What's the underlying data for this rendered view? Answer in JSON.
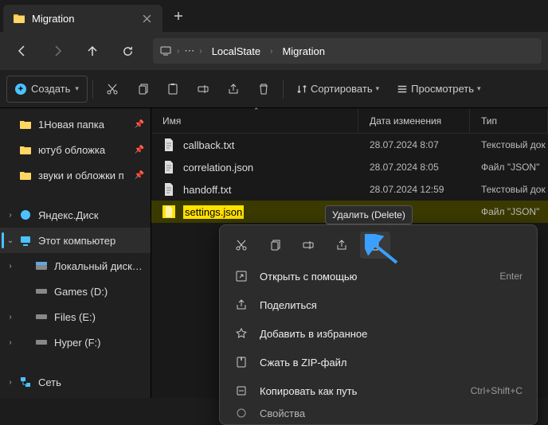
{
  "tab": {
    "title": "Migration"
  },
  "breadcrumb": {
    "items": [
      "LocalState",
      "Migration"
    ]
  },
  "toolbar": {
    "new_label": "Создать",
    "sort_label": "Сортировать",
    "view_label": "Просмотреть"
  },
  "sidebar": {
    "quick": [
      {
        "label": "1Новая папка",
        "pinned": true,
        "icon": "folder"
      },
      {
        "label": "ютуб обложка",
        "pinned": true,
        "icon": "folder"
      },
      {
        "label": "звуки и обложки п",
        "pinned": true,
        "icon": "folder"
      }
    ],
    "ydisk": "Яндекс.Диск",
    "thispc": "Этот компьютер",
    "drives": [
      {
        "label": "Локальный диск (C:)"
      },
      {
        "label": "Games (D:)"
      },
      {
        "label": "Files (E:)"
      },
      {
        "label": "Hyper (F:)"
      }
    ],
    "network": "Сеть"
  },
  "columns": {
    "name": "Имя",
    "date": "Дата изменения",
    "type": "Тип"
  },
  "files": [
    {
      "name": "callback.txt",
      "date": "28.07.2024 8:07",
      "type": "Текстовый док",
      "kind": "txt"
    },
    {
      "name": "correlation.json",
      "date": "28.07.2024 8:05",
      "type": "Файл \"JSON\"",
      "kind": "json"
    },
    {
      "name": "handoff.txt",
      "date": "28.07.2024 12:59",
      "type": "Текстовый док",
      "kind": "txt"
    },
    {
      "name": "settings.json",
      "date": "4 12:58",
      "type": "Файл \"JSON\"",
      "kind": "json"
    }
  ],
  "tooltip": "Удалить (Delete)",
  "context": {
    "open_with": "Открыть с помощью",
    "open_hint": "Enter",
    "share": "Поделиться",
    "favorite": "Добавить в избранное",
    "zip": "Сжать в ZIP-файл",
    "copypath": "Копировать как путь",
    "copypath_hint": "Ctrl+Shift+C",
    "properties": "Свойства"
  }
}
